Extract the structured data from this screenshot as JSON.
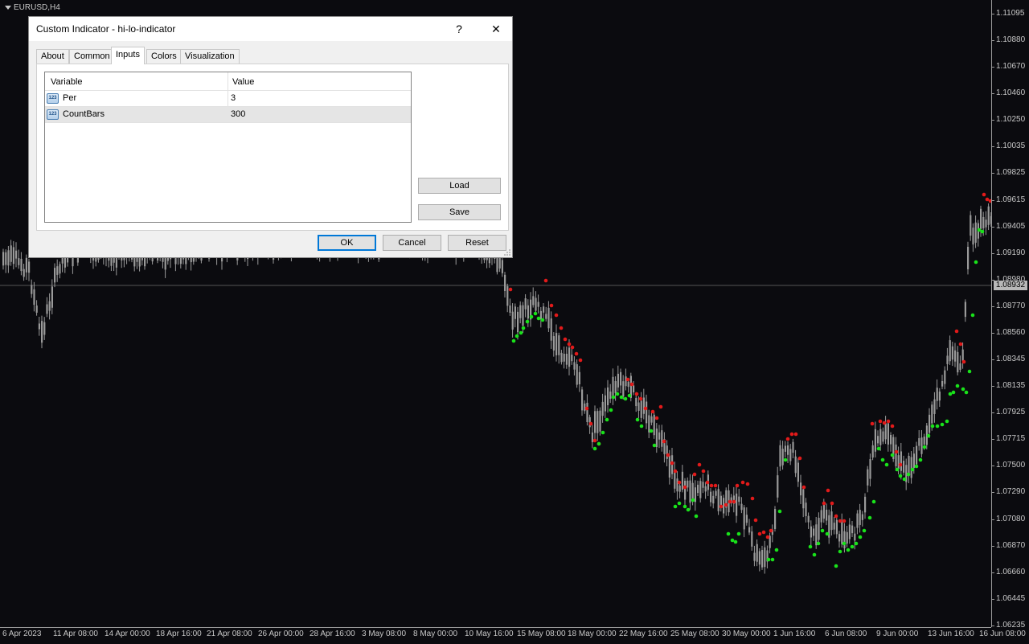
{
  "chart": {
    "symbol": "EURUSD,H4",
    "current_price": "1.08932",
    "price_ticks": [
      "1.11095",
      "1.10880",
      "1.10670",
      "1.10460",
      "1.10250",
      "1.10035",
      "1.09825",
      "1.09615",
      "1.09405",
      "1.09190",
      "1.08980",
      "1.08770",
      "1.08560",
      "1.08345",
      "1.08135",
      "1.07925",
      "1.07715",
      "1.07500",
      "1.07290",
      "1.07080",
      "1.06870",
      "1.06660",
      "1.06445",
      "1.06235"
    ],
    "time_ticks": [
      "6 Apr 2023",
      "11 Apr 08:00",
      "14 Apr 00:00",
      "18 Apr 16:00",
      "21 Apr 08:00",
      "26 Apr 00:00",
      "28 Apr 16:00",
      "3 May 08:00",
      "8 May 00:00",
      "10 May 16:00",
      "15 May 08:00",
      "18 May 00:00",
      "22 May 16:00",
      "25 May 08:00",
      "30 May 00:00",
      "1 Jun 16:00",
      "6 Jun 08:00",
      "9 Jun 00:00",
      "13 Jun 16:00",
      "16 Jun 08:00"
    ],
    "colors": {
      "background": "#0b0b0f",
      "candle": "#9a9a9a",
      "dot_high": "#e21a1a",
      "dot_low": "#19e21a",
      "axis": "#9a9a9a"
    }
  },
  "dialog": {
    "title": "Custom Indicator - hi-lo-indicator",
    "help_icon": "question-icon",
    "close_icon": "close-icon",
    "tabs": [
      "About",
      "Common",
      "Inputs",
      "Colors",
      "Visualization"
    ],
    "active_tab": "Inputs",
    "grid": {
      "headers": [
        "Variable",
        "Value"
      ],
      "rows": [
        {
          "icon": "123",
          "name": "Per",
          "value": "3"
        },
        {
          "icon": "123",
          "name": "CountBars",
          "value": "300"
        }
      ]
    },
    "buttons": {
      "load": "Load",
      "save": "Save",
      "ok": "OK",
      "cancel": "Cancel",
      "reset": "Reset"
    }
  }
}
